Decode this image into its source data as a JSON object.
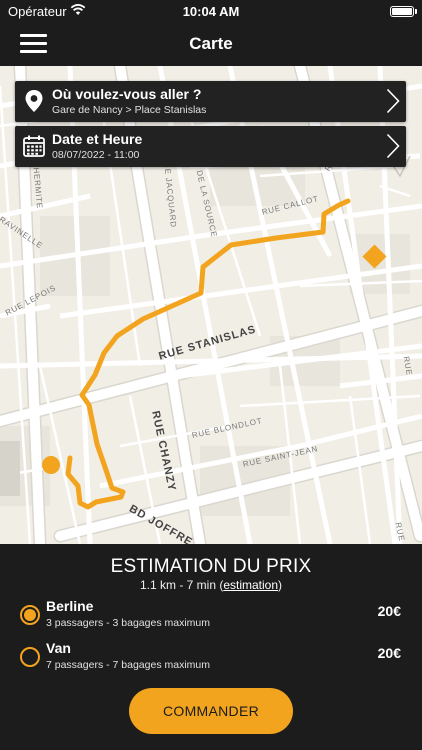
{
  "status_bar": {
    "carrier": "Opérateur",
    "time": "10:04 AM",
    "icons": [
      "wifi-icon",
      "battery-icon"
    ]
  },
  "header": {
    "title": "Carte",
    "menu_icon": "hamburger-menu-icon"
  },
  "destination_card": {
    "title": "Où voulez-vous aller ?",
    "subtitle": "Gare de Nancy > Place Stanislas",
    "icon": "location-pin-icon"
  },
  "datetime_card": {
    "title": "Date et Heure",
    "subtitle": "08/07/2022 - 11:00",
    "icon": "calendar-icon"
  },
  "map": {
    "streets": {
      "ermite": "HERMITE",
      "ravinelle": "RAVINELLE",
      "jacquard": "RUE JACQUARD",
      "source": "DE LA SOURCE",
      "callot": "RUE CALLOT",
      "lepois": "RUE LEPOIS",
      "stanislas": "RUE STANISLAS",
      "blondlot": "RUE BLONDLOT",
      "saint_jean": "RUE SAINT-JEAN",
      "chanzy": "RUE CHANZY",
      "joffre": "BD JOFFRE",
      "rue_right": "RUE",
      "rue_top": "RUE",
      "rue_far_right": "RUE"
    },
    "colors": {
      "route": "#f2a41e",
      "background": "#f1eee6",
      "road": "#ffffff",
      "road_outline": "#dad7cf",
      "block": "#e8e5dc"
    }
  },
  "estimate": {
    "title": "ESTIMATION DU PRIX",
    "info_prefix": "1.1 km - 7 min (",
    "info_link": "estimation",
    "info_suffix": ")"
  },
  "vehicles": [
    {
      "name": "Berline",
      "description": "3 passagers - 3 bagages maximum",
      "price": "20€",
      "selected": true
    },
    {
      "name": "Van",
      "description": "7 passagers - 7 bagages maximum",
      "price": "20€",
      "selected": false
    }
  ],
  "order_button": {
    "label": "COMMANDER"
  },
  "accent_color": "#f2a41e"
}
